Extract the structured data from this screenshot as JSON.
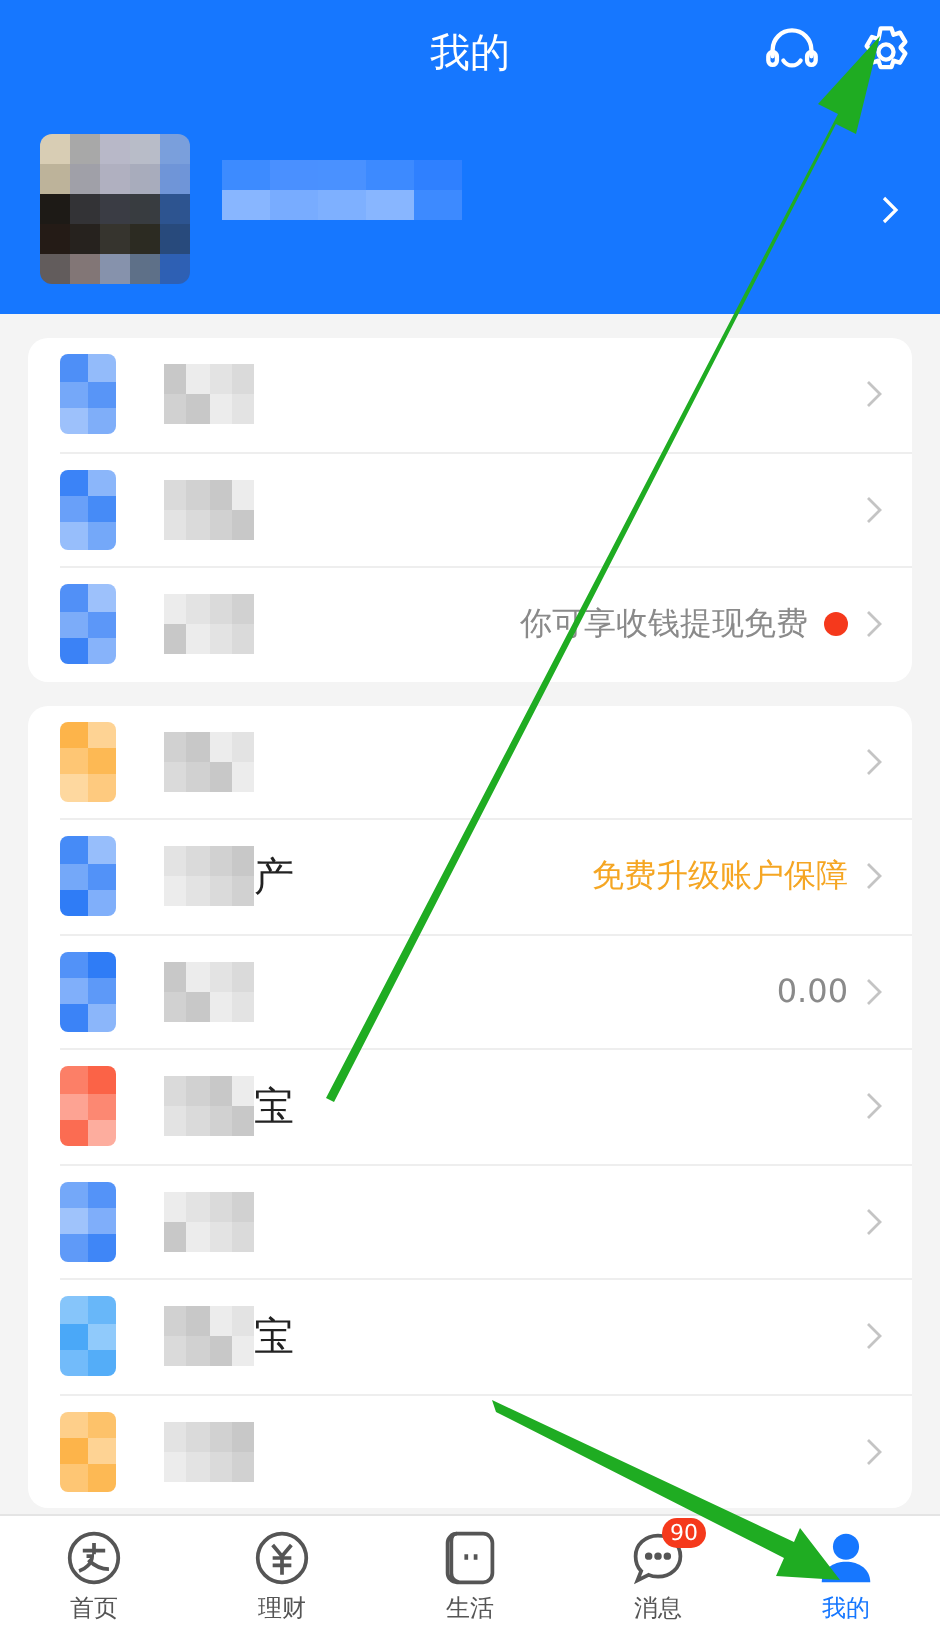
{
  "header": {
    "title": "我的"
  },
  "profile": {
    "kind": "pixelated"
  },
  "groups": [
    {
      "rows": [
        {
          "color": "#4e8ff7",
          "dot": false
        },
        {
          "color": "#2f7cf6",
          "dot": false
        },
        {
          "color": "#3b82f6",
          "note": "你可享收钱提现免费",
          "note_highlight": false,
          "dot": true
        }
      ]
    },
    {
      "rows": [
        {
          "color": "#fdb03f",
          "dot": false
        },
        {
          "color": "#2f7cf6",
          "label_tail": "产",
          "note": "免费升级账户保障",
          "note_highlight": true,
          "dot": false
        },
        {
          "color": "#2f7cf6",
          "note": "0.00",
          "note_highlight": false,
          "dot": false
        },
        {
          "color": "#fb5a3c",
          "label_tail": "宝",
          "dot": false
        },
        {
          "color": "#3f86f7",
          "dot": false
        },
        {
          "color": "#4aa8f8",
          "label_tail": "宝",
          "dot": false
        },
        {
          "color": "#fdb03f",
          "dot": false
        }
      ]
    }
  ],
  "tabs": [
    {
      "label": "首页",
      "kind": "home",
      "selected": false
    },
    {
      "label": "理财",
      "kind": "wealth",
      "selected": false
    },
    {
      "label": "生活",
      "kind": "life",
      "selected": false
    },
    {
      "label": "消息",
      "kind": "message",
      "selected": false,
      "badge": "90"
    },
    {
      "label": "我的",
      "kind": "me",
      "selected": true
    }
  ]
}
